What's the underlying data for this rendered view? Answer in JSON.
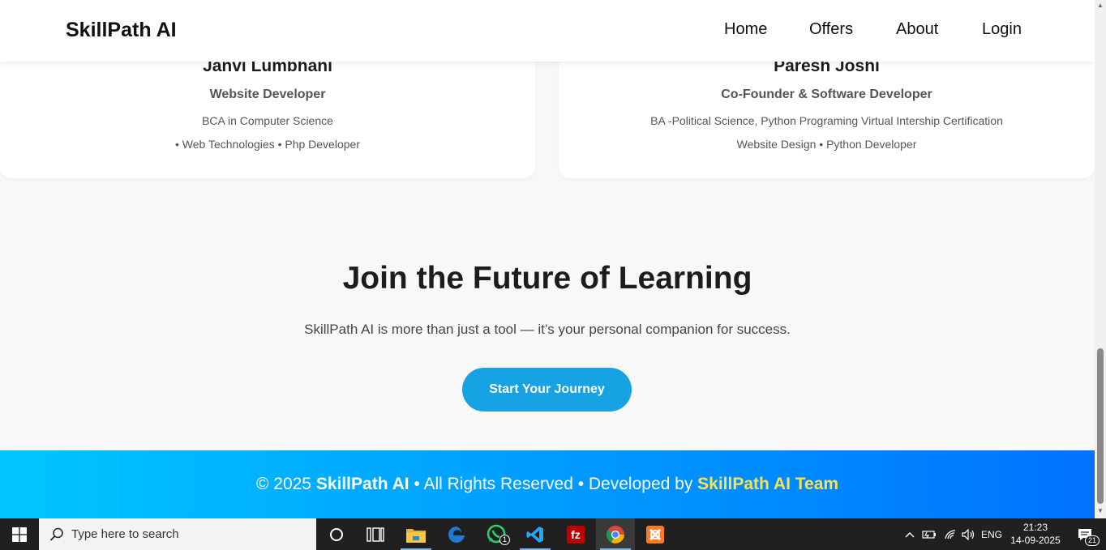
{
  "header": {
    "brand": "SkillPath AI",
    "nav": [
      "Home",
      "Offers",
      "About",
      "Login"
    ]
  },
  "team": [
    {
      "name": "Janvi Lumbhani",
      "role": "Website Developer",
      "education": "BCA in Computer Science",
      "skills": "• Web Technologies • Php Developer"
    },
    {
      "name": "Paresh Joshi",
      "role": "Co-Founder & Software Developer",
      "education": "BA -Political Science, Python Programing Virtual Intership Certification",
      "skills": "Website Design • Python Developer"
    }
  ],
  "cta": {
    "title": "Join the Future of Learning",
    "text": "SkillPath AI is more than just a tool — it’s your personal companion for success.",
    "button": "Start Your Journey"
  },
  "footer": {
    "prefix": "© 2025",
    "brand": "SkillPath AI",
    "middle": "• All Rights Reserved • Developed by",
    "team": "SkillPath AI Team"
  },
  "taskbar": {
    "search_placeholder": "Type here to search",
    "whatsapp_badge": "1",
    "language": "ENG",
    "time": "21:23",
    "date": "14-09-2025",
    "notification_count": "21"
  },
  "colors": {
    "cta_button": "#17a2e3",
    "footer_gradient_start": "#00c6ff",
    "footer_gradient_end": "#0072ff",
    "footer_team": "#ffe14d"
  }
}
